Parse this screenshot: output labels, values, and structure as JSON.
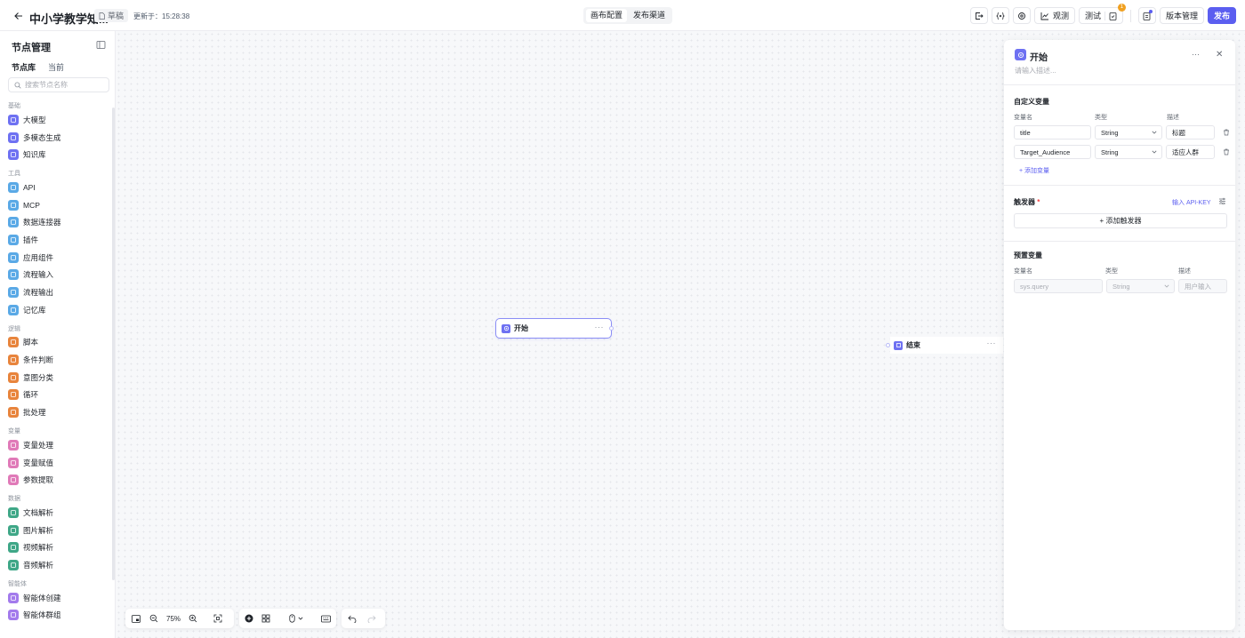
{
  "header": {
    "title": "中小学教学知...",
    "status": "草稿",
    "updated_label": "更新于：15:28:38",
    "tabs": [
      {
        "label": "画布配置"
      },
      {
        "label": "发布渠道"
      }
    ],
    "observe_label": "观测",
    "test_label": "测试",
    "badge_count": "1",
    "version_label": "版本管理",
    "publish_label": "发布"
  },
  "sidebar": {
    "title": "节点管理",
    "tabs": [
      "节点库",
      "当前"
    ],
    "search_placeholder": "搜索节点名称",
    "groups": [
      {
        "label": "基础",
        "color": "#6e71f2",
        "items": [
          "大模型",
          "多模态生成",
          "知识库"
        ]
      },
      {
        "label": "工具",
        "color": "#5aa9e6",
        "items": [
          "API",
          "MCP",
          "数据连接器",
          "插件",
          "应用组件",
          "流程输入",
          "流程输出",
          "记忆库"
        ]
      },
      {
        "label": "逻辑",
        "color": "#e8843c",
        "items": [
          "脚本",
          "条件判断",
          "意图分类",
          "循环",
          "批处理"
        ]
      },
      {
        "label": "变量",
        "color": "#e07ab8",
        "items": [
          "变量处理",
          "变量赋值",
          "参数提取"
        ]
      },
      {
        "label": "数据",
        "color": "#3fa787",
        "items": [
          "文档解析",
          "图片解析",
          "视频解析",
          "音频解析"
        ]
      },
      {
        "label": "智能体",
        "color": "#a37bec",
        "items": [
          "智能体创建",
          "智能体群组"
        ]
      }
    ]
  },
  "canvas": {
    "start_node": "开始",
    "end_node": "结束",
    "zoom": "75%"
  },
  "panel": {
    "title": "开始",
    "desc_placeholder": "请输入描述...",
    "custom_vars_title": "自定义变量",
    "col_name": "变量名",
    "col_type": "类型",
    "col_desc": "描述",
    "custom_vars": [
      {
        "name": "title",
        "type": "String",
        "desc": "标题"
      },
      {
        "name": "Target_Audience",
        "type": "String",
        "desc": "适应人群"
      }
    ],
    "add_var_label": "+ 添加变量",
    "trigger_title": "触发器",
    "api_key_label": "输入 API-KEY",
    "add_trigger_label": "+ 添加触发器",
    "preset_title": "预置变量",
    "preset_name": "sys.query",
    "preset_type": "String",
    "preset_desc": "用户输入"
  }
}
